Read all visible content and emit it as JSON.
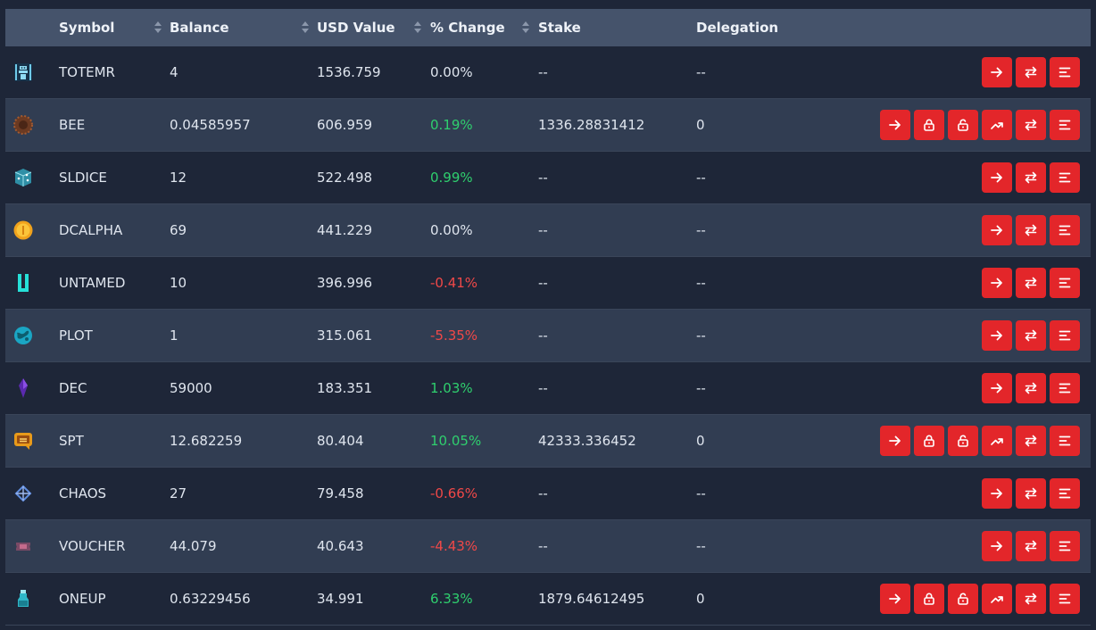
{
  "table": {
    "headers": {
      "symbol": "Symbol",
      "balance": "Balance",
      "usd_value": "USD Value",
      "change": "% Change",
      "stake": "Stake",
      "delegation": "Delegation"
    },
    "rows": [
      {
        "symbol": "TOTEMR",
        "balance": "4",
        "usd": "1536.759",
        "change": "0.00%",
        "trend": "neutral",
        "stake": "--",
        "delegation": "--",
        "stakeable": false,
        "icon": "totem-icon"
      },
      {
        "symbol": "BEE",
        "balance": "0.04585957",
        "usd": "606.959",
        "change": "0.19%",
        "trend": "up",
        "stake": "1336.28831412",
        "delegation": "0",
        "stakeable": true,
        "icon": "bee-icon"
      },
      {
        "symbol": "SLDICE",
        "balance": "12",
        "usd": "522.498",
        "change": "0.99%",
        "trend": "up",
        "stake": "--",
        "delegation": "--",
        "stakeable": false,
        "icon": "dice-icon"
      },
      {
        "symbol": "DCALPHA",
        "balance": "69",
        "usd": "441.229",
        "change": "0.00%",
        "trend": "neutral",
        "stake": "--",
        "delegation": "--",
        "stakeable": false,
        "icon": "coin-icon"
      },
      {
        "symbol": "UNTAMED",
        "balance": "10",
        "usd": "396.996",
        "change": "-0.41%",
        "trend": "down",
        "stake": "--",
        "delegation": "--",
        "stakeable": false,
        "icon": "untamed-icon"
      },
      {
        "symbol": "PLOT",
        "balance": "1",
        "usd": "315.061",
        "change": "-5.35%",
        "trend": "down",
        "stake": "--",
        "delegation": "--",
        "stakeable": false,
        "icon": "globe-icon"
      },
      {
        "symbol": "DEC",
        "balance": "59000",
        "usd": "183.351",
        "change": "1.03%",
        "trend": "up",
        "stake": "--",
        "delegation": "--",
        "stakeable": false,
        "icon": "crystal-icon"
      },
      {
        "symbol": "SPT",
        "balance": "12.682259",
        "usd": "80.404",
        "change": "10.05%",
        "trend": "up",
        "stake": "42333.336452",
        "delegation": "0",
        "stakeable": true,
        "icon": "spt-icon"
      },
      {
        "symbol": "CHAOS",
        "balance": "27",
        "usd": "79.458",
        "change": "-0.66%",
        "trend": "down",
        "stake": "--",
        "delegation": "--",
        "stakeable": false,
        "icon": "chaos-icon"
      },
      {
        "symbol": "VOUCHER",
        "balance": "44.079",
        "usd": "40.643",
        "change": "-4.43%",
        "trend": "down",
        "stake": "--",
        "delegation": "--",
        "stakeable": false,
        "icon": "voucher-icon"
      },
      {
        "symbol": "ONEUP",
        "balance": "0.63229456",
        "usd": "34.991",
        "change": "6.33%",
        "trend": "up",
        "stake": "1879.64612495",
        "delegation": "0",
        "stakeable": true,
        "icon": "potion-icon"
      }
    ]
  },
  "colors": {
    "header_bg": "#45536b",
    "row_odd_bg": "#313d52",
    "row_even_bg": "#1e2638",
    "action_button": "#e3262a",
    "positive": "#2fcf6e",
    "negative": "#f04848"
  },
  "action_icons": {
    "basic": [
      "transfer-arrow-icon",
      "swap-icon",
      "menu-icon"
    ],
    "stakeable": [
      "transfer-arrow-icon",
      "lock-icon",
      "unlock-icon",
      "trend-up-icon",
      "swap-icon",
      "menu-icon"
    ]
  }
}
